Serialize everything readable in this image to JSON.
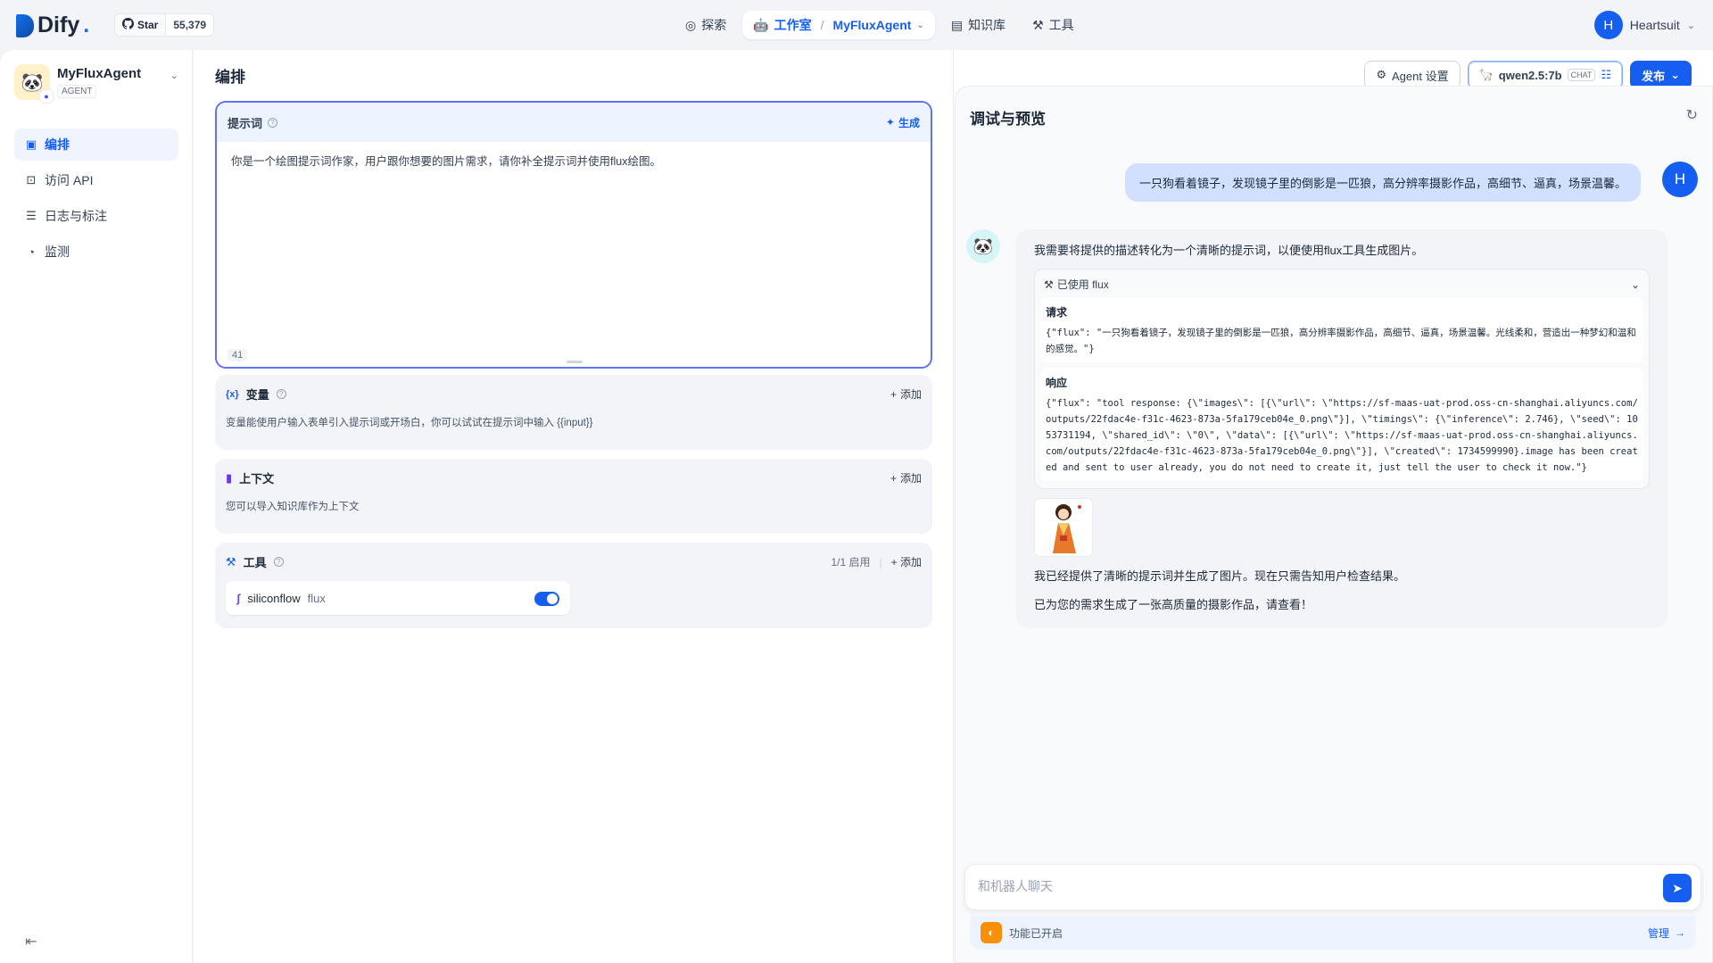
{
  "brand": {
    "name": "Dify",
    "dot": "."
  },
  "github": {
    "label": "Star",
    "count": "55,379"
  },
  "nav": {
    "explore": "探索",
    "studio": "工作室",
    "app": "MyFluxAgent",
    "knowledge": "知识库",
    "tools": "工具"
  },
  "user": {
    "initial": "H",
    "name": "Heartsuit"
  },
  "app": {
    "name": "MyFluxAgent",
    "type": "AGENT"
  },
  "sidebar": {
    "items": [
      {
        "label": "编排",
        "icon": "layout-icon"
      },
      {
        "label": "访问 API",
        "icon": "terminal-icon"
      },
      {
        "label": "日志与标注",
        "icon": "file-list-icon"
      },
      {
        "label": "监测",
        "icon": "gauge-icon"
      }
    ]
  },
  "editor": {
    "title": "编排",
    "prompt": {
      "label": "提示词",
      "generate": "生成",
      "text": "你是一个绘图提示词作家，用户跟你想要的图片需求，请你补全提示词并使用flux绘图。",
      "count": "41"
    },
    "variables": {
      "label": "变量",
      "add": "添加",
      "desc": "变量能使用户输入表单引入提示词或开场白，你可以试试在提示词中输入 {{input}}"
    },
    "context": {
      "label": "上下文",
      "add": "添加",
      "desc": "您可以导入知识库作为上下文"
    },
    "tools": {
      "label": "工具",
      "enabled": "1/1 启用",
      "add": "添加",
      "item_provider": "siliconflow",
      "item_name": "flux"
    }
  },
  "toolbar": {
    "agent_settings": "Agent 设置",
    "model": "qwen2.5:7b",
    "model_mode": "CHAT",
    "publish": "发布"
  },
  "preview": {
    "title": "调试与预览",
    "user_message": "一只狗看着镜子，发现镜子里的倒影是一匹狼，高分辨率摄影作品，高细节、逼真，场景温馨。",
    "bot_intro": "我需要将提供的描述转化为一个清晰的提示词，以便使用flux工具生成图片。",
    "tool_used": "已使用 flux",
    "request_label": "请求",
    "request_text": "{\"flux\": \"一只狗看着镜子，发现镜子里的倒影是一匹狼，高分辨率摄影作品，高细节、逼真，场景温馨。光线柔和，营造出一种梦幻和温和的感觉。\"}",
    "response_label": "响应",
    "response_text": "{\"flux\": \"tool response: {\\\"images\\\": [{\\\"url\\\": \\\"https://sf-maas-uat-prod.oss-cn-shanghai.aliyuncs.com/outputs/22fdac4e-f31c-4623-873a-5fa179ceb04e_0.png\\\"}], \\\"timings\\\": {\\\"inference\\\": 2.746}, \\\"seed\\\": 1053731194, \\\"shared_id\\\": \\\"0\\\", \\\"data\\\": [{\\\"url\\\": \\\"https://sf-maas-uat-prod.oss-cn-shanghai.aliyuncs.com/outputs/22fdac4e-f31c-4623-873a-5fa179ceb04e_0.png\\\"}], \\\"created\\\": 1734599990}.image has been created and sent to user already, you do not need to create it, just tell the user to check it now.\"}",
    "bot_followup": "我已经提供了清晰的提示词并生成了图片。现在只需告知用户检查结果。",
    "bot_final": "已为您的需求生成了一张高质量的摄影作品，请查看！",
    "input_placeholder": "和机器人聊天",
    "features": "功能已开启",
    "manage": "管理"
  },
  "colors": {
    "accent": "#155eef",
    "prompt_border": "#6172f3",
    "user_bubble": "#d1e0ff"
  }
}
